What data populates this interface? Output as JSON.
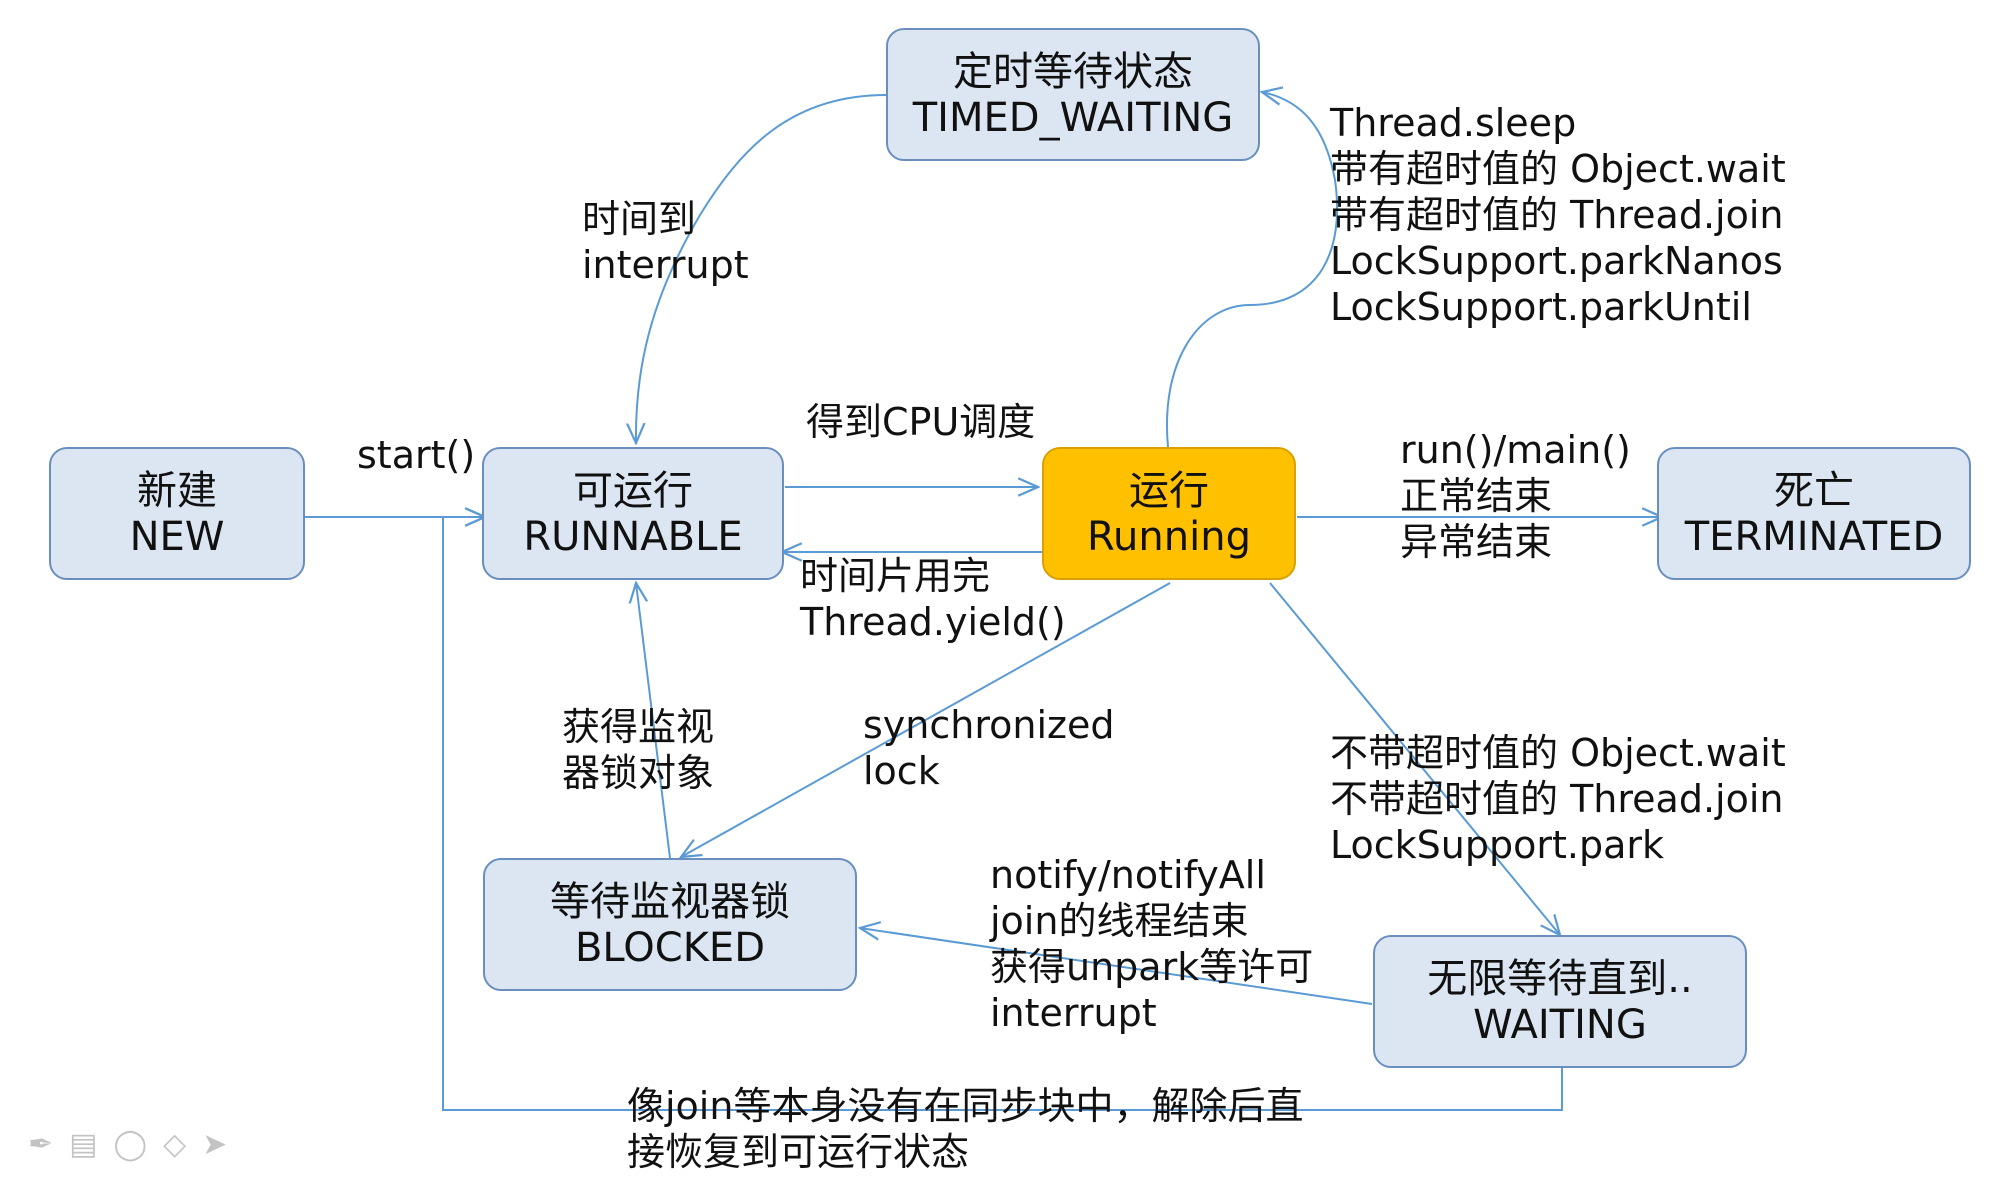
{
  "states": {
    "new": {
      "line1": "新建",
      "line2": "NEW"
    },
    "runnable": {
      "line1": "可运行",
      "line2": "RUNNABLE"
    },
    "running": {
      "line1": "运行",
      "line2": "Running"
    },
    "terminated": {
      "line1": "死亡",
      "line2": "TERMINATED"
    },
    "timed_waiting": {
      "line1": "定时等待状态",
      "line2": "TIMED_WAITING"
    },
    "blocked": {
      "line1": "等待监视器锁",
      "line2": "BLOCKED"
    },
    "waiting": {
      "line1": "无限等待直到..",
      "line2": "WAITING"
    }
  },
  "labels": {
    "start": "start()",
    "cpu_scheduled": "得到CPU调度",
    "timeslice": [
      "时间片用完",
      "Thread.yield()"
    ],
    "timed_out": [
      "时间到",
      "interrupt"
    ],
    "timed_wait_triggers": [
      "Thread.sleep",
      "带有超时值的 Object.wait",
      "带有超时值的 Thread.join",
      "LockSupport.parkNanos",
      "LockSupport.parkUntil"
    ],
    "finish": [
      "run()/main()",
      "正常结束",
      "异常结束"
    ],
    "acquire_monitor": [
      "获得监视",
      "器锁对象"
    ],
    "sync_lock": [
      "synchronized",
      "lock"
    ],
    "wait_triggers": [
      "不带超时值的 Object.wait",
      "不带超时值的 Thread.join",
      "LockSupport.park"
    ],
    "wakeups": [
      "notify/notifyAll",
      "join的线程结束",
      "获得unpark等许可",
      "interrupt"
    ],
    "direct_resume": [
      "像join等本身没有在同步块中，解除后直",
      "接恢复到可运行状态"
    ]
  },
  "colors": {
    "edge": "#5b9bd5",
    "state_fill": "#dce6f2",
    "running_fill": "#ffc000"
  },
  "toolbar_icons": [
    "pen-icon",
    "note-icon",
    "shape-icon",
    "eraser-icon",
    "pointer-icon"
  ]
}
